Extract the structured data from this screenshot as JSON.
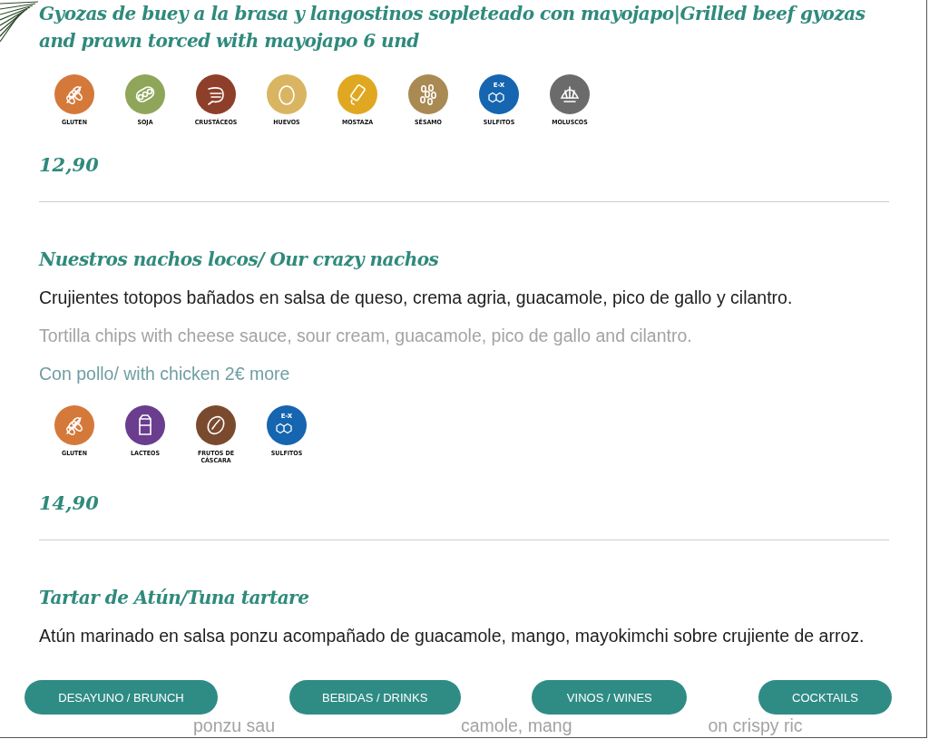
{
  "dishes": [
    {
      "title": "Gyozas de buey a la brasa y langostinos sopleteado  con mayojapo|Grilled beef gyozas and prawn torced with mayojapo 6 und",
      "allergens": [
        {
          "kind": "gluten",
          "label": "GLUTEN",
          "color": "#d4793a"
        },
        {
          "kind": "soja",
          "label": "SOJA",
          "color": "#8fa65a"
        },
        {
          "kind": "crustaceos",
          "label": "CRUSTÁCEOS",
          "color": "#8e3f2a"
        },
        {
          "kind": "huevos",
          "label": "HUEVOS",
          "color": "#d9b562"
        },
        {
          "kind": "mostaza",
          "label": "MOSTAZA",
          "color": "#e0a820"
        },
        {
          "kind": "sesamo",
          "label": "SÉSAMO",
          "color": "#a98a52"
        },
        {
          "kind": "sulfitos",
          "label": "SULFITOS",
          "color": "#1565b0",
          "badge": "E-X"
        },
        {
          "kind": "moluscos",
          "label": "MOLUSCOS",
          "color": "#6b6b6b"
        }
      ],
      "price": "12,90"
    },
    {
      "title": "Nuestros nachos locos/ Our crazy nachos",
      "lines": [
        {
          "kind": "main",
          "text": "Crujientes totopos bañados en salsa de queso, crema agria, guacamole, pico de gallo y cilantro."
        },
        {
          "kind": "translation",
          "text": "Tortilla chips with cheese sauce, sour cream, guacamole, pico de gallo and cilantro."
        },
        {
          "kind": "note",
          "text": "Con pollo/ with chicken 2€ more"
        }
      ],
      "allergens": [
        {
          "kind": "gluten",
          "label": "GLUTEN",
          "color": "#d4793a"
        },
        {
          "kind": "lacteos",
          "label": "LACTEOS",
          "color": "#6a3d8e"
        },
        {
          "kind": "frutos",
          "label": "FRUTOS DE CÁSCARA",
          "color": "#7a4a2e"
        },
        {
          "kind": "sulfitos",
          "label": "SULFITOS",
          "color": "#1565b0",
          "badge": "E-X"
        }
      ],
      "price": "14,90"
    },
    {
      "title": "Tartar de Atún/Tuna tartare",
      "lines": [
        {
          "kind": "main",
          "text": "Atún marinado en salsa ponzu acompañado de guacamole, mango, mayokimchi sobre crujiente de arroz."
        },
        {
          "kind": "fragments",
          "parts": [
            "ponzu sau",
            "camole, mang",
            "on crispy ric"
          ]
        }
      ]
    }
  ],
  "nav": [
    "DESAYUNO / BRUNCH",
    "BEBIDAS / DRINKS",
    "VINOS / WINES",
    "COCKTAILS"
  ]
}
